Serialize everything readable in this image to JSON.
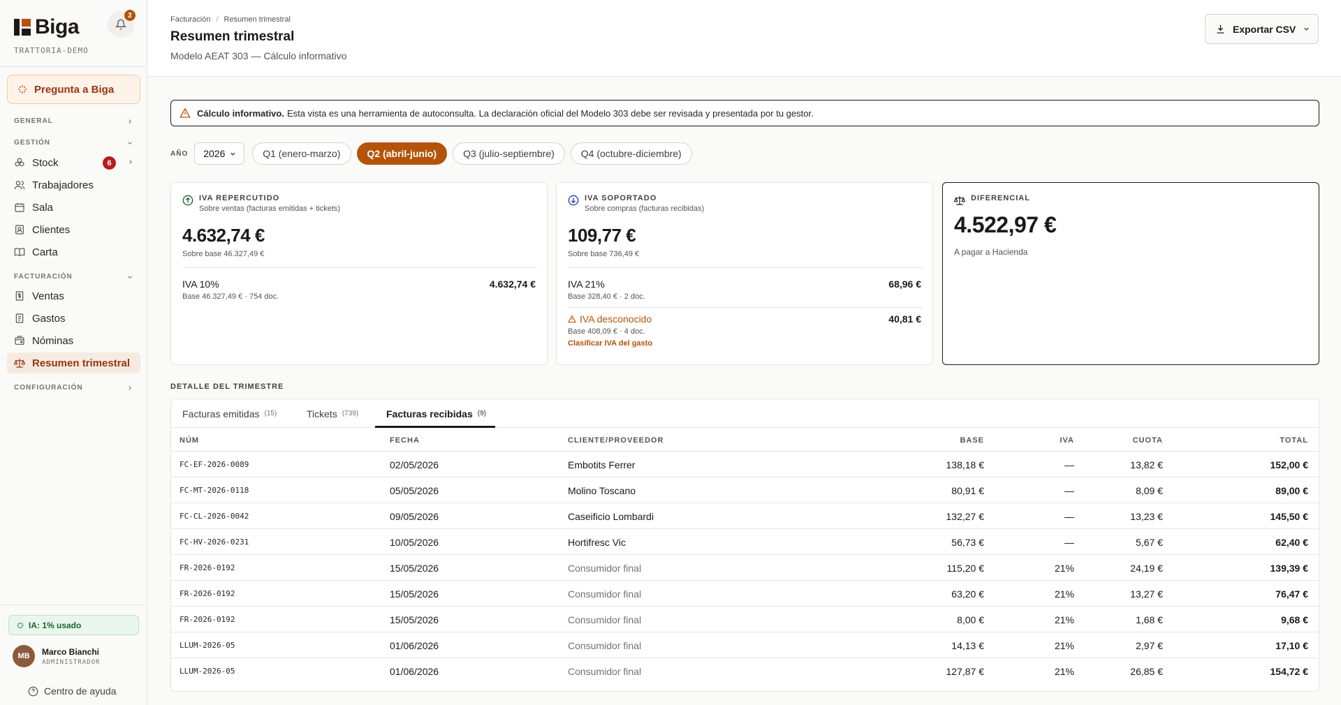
{
  "sidebar": {
    "logo": "Biga",
    "tenant": "TRATTORIA-DEMO",
    "notifications_count": "2",
    "ask_label": "Pregunta a Biga",
    "sections": {
      "general": "GENERAL",
      "gestion": "GESTIÓN",
      "facturacion": "FACTURACIÓN",
      "configuracion": "CONFIGURACIÓN"
    },
    "gestion_items": [
      {
        "label": "Stock",
        "badge": "6",
        "icon": "boxes-icon"
      },
      {
        "label": "Trabajadores",
        "icon": "users-icon"
      },
      {
        "label": "Sala",
        "icon": "calendar-icon"
      },
      {
        "label": "Clientes",
        "icon": "contact-icon"
      },
      {
        "label": "Carta",
        "icon": "book-icon"
      }
    ],
    "facturacion_items": [
      {
        "label": "Ventas",
        "icon": "receipt-icon"
      },
      {
        "label": "Gastos",
        "icon": "document-icon"
      },
      {
        "label": "Nóminas",
        "icon": "wallet-icon"
      },
      {
        "label": "Resumen trimestral",
        "icon": "scale-icon",
        "active": true
      }
    ],
    "ai_usage": "IA: 1% usado",
    "user": {
      "initials": "MB",
      "name": "Marco Bianchi",
      "role": "ADMINISTRADOR"
    },
    "help": "Centro de ayuda"
  },
  "header": {
    "breadcrumb": [
      "Facturación",
      "Resumen trimestral"
    ],
    "title": "Resumen trimestral",
    "subtitle": "Modelo AEAT 303 — Cálculo informativo",
    "export_label": "Exportar CSV"
  },
  "banner": {
    "strong": "Cálculo informativo.",
    "text": "Esta vista es una herramienta de autoconsulta. La declaración oficial del Modelo 303 debe ser revisada y presentada por tu gestor."
  },
  "filters": {
    "year_label": "AÑO",
    "year": "2026",
    "quarters": [
      "Q1 (enero-marzo)",
      "Q2 (abril-junio)",
      "Q3 (julio-septiembre)",
      "Q4 (octubre-diciembre)"
    ],
    "active_quarter": 1
  },
  "cards": {
    "repercutido": {
      "label": "IVA REPERCUTIDO",
      "sub": "Sobre ventas (facturas emitidas + tickets)",
      "amount": "4.632,74 €",
      "base": "Sobre base 46.327,49 €",
      "lines": [
        {
          "name": "IVA 10%",
          "meta": "Base 46.327,49 € · 754 doc.",
          "value": "4.632,74 €"
        }
      ]
    },
    "soportado": {
      "label": "IVA SOPORTADO",
      "sub": "Sobre compras (facturas recibidas)",
      "amount": "109,77 €",
      "base": "Sobre base 736,49 €",
      "lines": [
        {
          "name": "IVA 21%",
          "meta": "Base 328,40 € · 2 doc.",
          "value": "68,96 €"
        },
        {
          "name": "IVA desconocido",
          "meta": "Base 408,09 € · 4 doc.",
          "value": "40,81 €",
          "link": "Clasificar IVA del gasto"
        }
      ]
    },
    "diferencial": {
      "label": "DIFERENCIAL",
      "amount": "4.522,97 €",
      "note": "A pagar a Hacienda"
    }
  },
  "detail": {
    "title": "DETALLE DEL TRIMESTRE",
    "tabs": [
      {
        "label": "Facturas emitidas",
        "count": "(15)"
      },
      {
        "label": "Tickets",
        "count": "(739)"
      },
      {
        "label": "Facturas recibidas",
        "count": "(9)"
      }
    ],
    "active_tab": 2,
    "columns": [
      "NÚM",
      "FECHA",
      "CLIENTE/PROVEEDOR",
      "BASE",
      "IVA",
      "CUOTA",
      "TOTAL"
    ],
    "rows": [
      [
        "FC-EF-2026-0089",
        "02/05/2026",
        "Embotits Ferrer",
        "138,18 €",
        "—",
        "13,82 €",
        "152,00 €"
      ],
      [
        "FC-MT-2026-0118",
        "05/05/2026",
        "Molino Toscano",
        "80,91 €",
        "—",
        "8,09 €",
        "89,00 €"
      ],
      [
        "FC-CL-2026-0042",
        "09/05/2026",
        "Caseificio Lombardi",
        "132,27 €",
        "—",
        "13,23 €",
        "145,50 €"
      ],
      [
        "FC-HV-2026-0231",
        "10/05/2026",
        "Hortifresc Vic",
        "56,73 €",
        "—",
        "5,67 €",
        "62,40 €"
      ],
      [
        "FR-2026-0192",
        "15/05/2026",
        "Consumidor final",
        "115,20 €",
        "21%",
        "24,19 €",
        "139,39 €"
      ],
      [
        "FR-2026-0192",
        "15/05/2026",
        "Consumidor final",
        "63,20 €",
        "21%",
        "13,27 €",
        "76,47 €"
      ],
      [
        "FR-2026-0192",
        "15/05/2026",
        "Consumidor final",
        "8,00 €",
        "21%",
        "1,68 €",
        "9,68 €"
      ],
      [
        "LLUM-2026-05",
        "01/06/2026",
        "Consumidor final",
        "14,13 €",
        "21%",
        "2,97 €",
        "17,10 €"
      ],
      [
        "LLUM-2026-05",
        "01/06/2026",
        "Consumidor final",
        "127,87 €",
        "21%",
        "26,85 €",
        "154,72 €"
      ]
    ],
    "muted_client": "Consumidor final"
  },
  "colors": {
    "accent": "#b45309",
    "accent_bg": "#fef3e8",
    "danger": "#b91c1c",
    "success": "#166534",
    "text": "#1c1917"
  }
}
